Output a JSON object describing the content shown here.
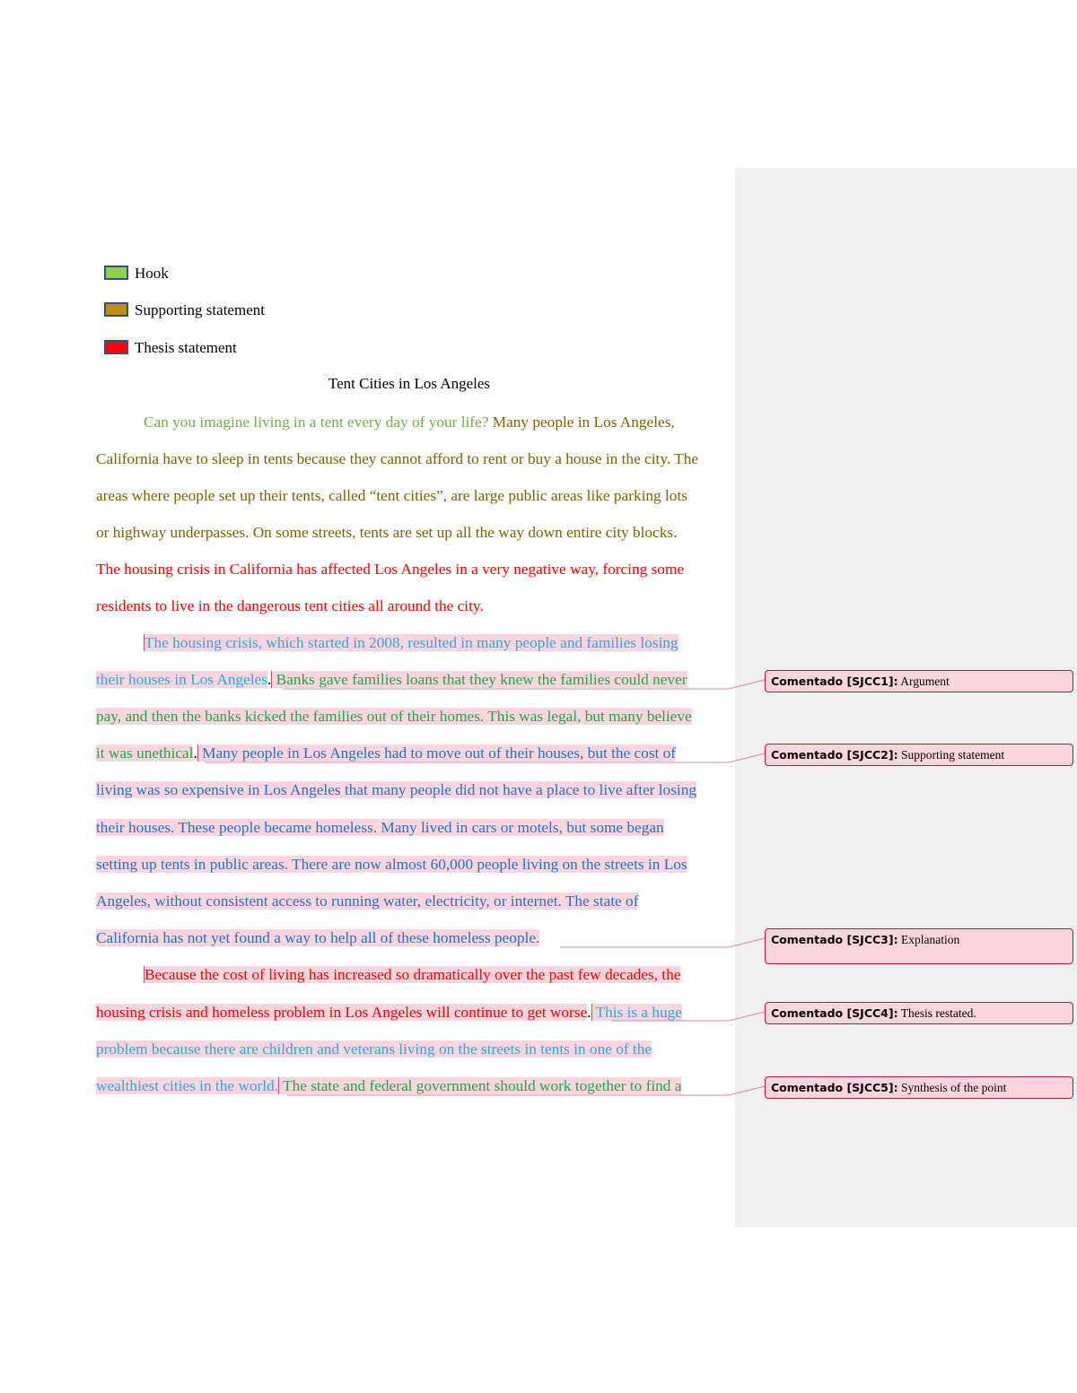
{
  "legend": [
    {
      "label": "Hook",
      "color": "#92d050"
    },
    {
      "label": "Supporting statement",
      "color": "#bf8f00"
    },
    {
      "label": "Thesis statement",
      "color": "#ff0000"
    }
  ],
  "document": {
    "title": "Tent Cities in Los Angeles",
    "paragraph1": {
      "line1_hook": "Can you imagine living in a tent every day of your life?",
      "line1_support": " Many people in Los Angeles,",
      "line2": "California have to sleep in tents because they cannot afford to rent or buy a house in the city. The",
      "line3": "areas where people set up their tents, called “tent cities”, are large public areas like parking lots",
      "line4": "or highway underpasses. On some streets, tents are set up all the way down entire city blocks.",
      "line5": "The housing crisis in California has affected Los Angeles in a very negative way, forcing some",
      "line6": "residents to live in the dangerous tent cities all around the city."
    },
    "paragraph2": {
      "line1": "The housing crisis, which started in 2008, resulted in many people and families losing",
      "line2a": "their houses in Los Angeles",
      "line2b": ".",
      "line2c": " Banks gave families loans that they knew the families could never",
      "line3": "pay, and then the banks kicked the families out of their homes. This was legal, but many believe",
      "line4a": "it was unethical",
      "line4b": ".",
      "line4c": " Many people in Los Angeles had to move out of their houses, but the cost of",
      "line5": "living was so expensive in Los Angeles that many people did not have a place to live after losing",
      "line6": "their houses. These people became homeless. Many lived in cars or motels, but some began",
      "line7": "setting up tents in public areas. There are now almost 60,000 people living on the streets in Los",
      "line8": "Angeles, without consistent access to running water, electricity, or internet. The state of",
      "line9": "California has not yet found a way to help all of these homeless people."
    },
    "paragraph3": {
      "line1": "Because the cost of living has increased so dramatically over the past few decades, the",
      "line2a": "housing crisis and homeless problem in Los Angeles will continue to get worse",
      "line2b": ".",
      "line2c": " This is a huge",
      "line3": "problem because there are children and veterans living on the streets in tents in one of the",
      "line4a": "wealthiest cities in the world.",
      "line4c": " The state and federal government should work together to find a"
    }
  },
  "comments": [
    {
      "author": "Comentado [SJCC1]:",
      "text": " Argument"
    },
    {
      "author": "Comentado [SJCC2]:",
      "text": " Supporting statement"
    },
    {
      "author": "Comentado [SJCC3]:",
      "text": " Explanation"
    },
    {
      "author": "Comentado [SJCC4]:",
      "text": " Thesis restated."
    },
    {
      "author": "Comentado [SJCC5]:",
      "text": " Synthesis of the point"
    }
  ],
  "colors": {
    "highlight": "#fcd5de",
    "comment_border": "#c0143c",
    "sidebar": "#f0f0f0"
  }
}
